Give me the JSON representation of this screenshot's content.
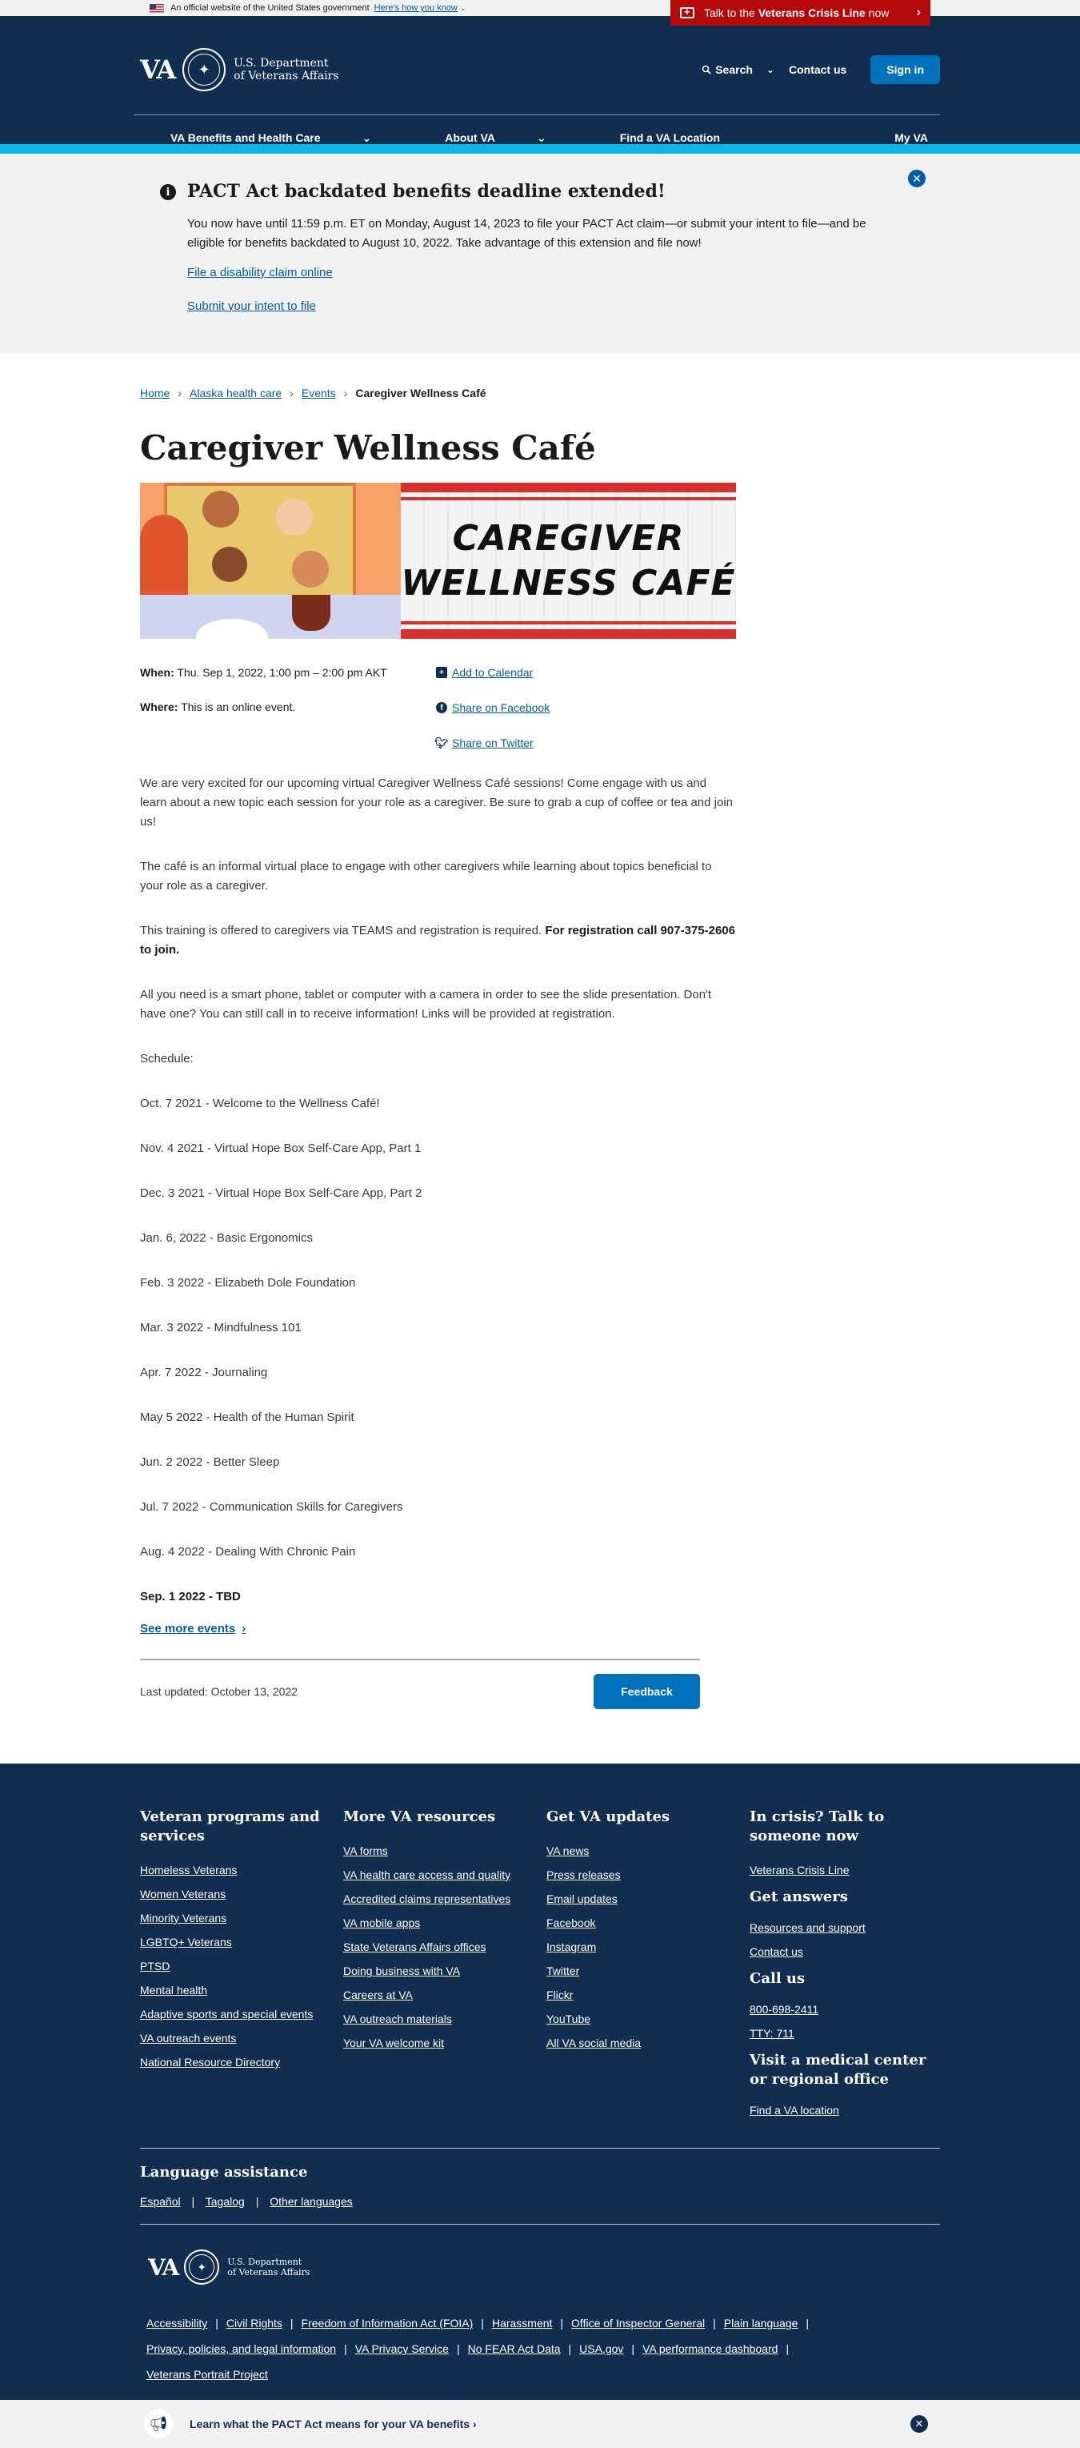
{
  "official_banner": {
    "text": "An official website of the United States government",
    "link": "Here's how you know"
  },
  "crisis_line": {
    "prefix": "Talk to the",
    "bold": "Veterans Crisis Line",
    "suffix": "now"
  },
  "header": {
    "logo_text": "VA",
    "dept_line1": "U.S. Department",
    "dept_line2": "of Veterans Affairs",
    "search_label": "Search",
    "contact_label": "Contact us",
    "signin_label": "Sign in",
    "nav": [
      "VA Benefits and Health Care",
      "About VA",
      "Find a VA Location"
    ],
    "myva": "My VA"
  },
  "alert": {
    "title": "PACT Act backdated benefits deadline extended!",
    "body": "You now have until 11:59 p.m. ET on Monday, August 14, 2023 to file your PACT Act claim—or submit your intent to file—and be eligible for benefits backdated to August 10, 2022. Take advantage of this extension and file now!",
    "link1": "File a disability claim online",
    "link2": "Submit your intent to file"
  },
  "breadcrumb": {
    "items": [
      "Home",
      "Alaska health care",
      "Events"
    ],
    "current": "Caregiver Wellness Café"
  },
  "page": {
    "title": "Caregiver Wellness Café",
    "hero_line1": "CAREGIVER",
    "hero_line2": "WELLNESS CAFÉ",
    "when_label": "When:",
    "when_value": "Thu. Sep 1, 2022, 1:00 pm – 2:00 pm AKT",
    "where_label": "Where:",
    "where_value": "This is an online event.",
    "add_calendar": "Add to Calendar",
    "share_facebook": "Share on Facebook",
    "share_twitter": "Share on Twitter",
    "p1": "We are very excited for our upcoming virtual Caregiver Wellness Café sessions! Come engage with us and learn about a new topic each session for your role as a caregiver. Be sure to grab a cup of coffee or tea and join us!",
    "p2": "The café is an informal virtual place to engage with other caregivers while learning about topics beneficial to your role as a caregiver.",
    "p3_plain": "This training is offered to caregivers via TEAMS and registration is required.",
    "p3_bold": "For registration call 907-375-2606 to join.",
    "p4": "All you need is a smart phone, tablet or computer with a camera in order to see the slide presentation. Don't have one? You can still call in to receive information! Links will be provided at registration.",
    "schedule_label": "Schedule:",
    "schedule": [
      "Oct. 7 2021 - Welcome to the Wellness Café!",
      "Nov. 4 2021 - Virtual Hope Box Self-Care App, Part 1",
      "Dec. 3 2021 - Virtual Hope Box Self-Care App, Part 2",
      "Jan. 6, 2022 - Basic Ergonomics",
      "Feb. 3 2022 - Elizabeth Dole Foundation",
      "Mar. 3 2022 - Mindfulness 101",
      "Apr. 7 2022 - Journaling",
      "May 5 2022 - Health of the Human Spirit",
      "Jun. 2 2022 - Better Sleep",
      "Jul. 7 2022 - Communication Skills for Caregivers",
      "Aug. 4 2022 - Dealing With Chronic Pain"
    ],
    "schedule_last": "Sep. 1 2022 - TBD",
    "see_more": "See more events",
    "last_updated": "Last updated: October 13, 2022",
    "feedback": "Feedback"
  },
  "footer": {
    "col1_title": "Veteran programs and services",
    "col1_links": [
      "Homeless Veterans",
      "Women Veterans",
      "Minority Veterans",
      "LGBTQ+ Veterans",
      "PTSD",
      "Mental health",
      "Adaptive sports and special events",
      "VA outreach events",
      "National Resource Directory"
    ],
    "col2_title": "More VA resources",
    "col2_links": [
      "VA forms",
      "VA health care access and quality",
      "Accredited claims representatives",
      "VA mobile apps",
      "State Veterans Affairs offices",
      "Doing business with VA",
      "Careers at VA",
      "VA outreach materials",
      "Your VA welcome kit"
    ],
    "col3_title": "Get VA updates",
    "col3_links": [
      "VA news",
      "Press releases",
      "Email updates",
      "Facebook",
      "Instagram",
      "Twitter",
      "Flickr",
      "YouTube",
      "All VA social media"
    ],
    "col4_title1": "In crisis? Talk to someone now",
    "col4_link1": "Veterans Crisis Line",
    "col4_title2": "Get answers",
    "col4_links2": [
      "Resources and support",
      "Contact us"
    ],
    "col4_title3": "Call us",
    "col4_links3": [
      "800-698-2411",
      "TTY: 711"
    ],
    "col4_title4": "Visit a medical center or regional office",
    "col4_link4": "Find a VA location",
    "lang_title": "Language assistance",
    "lang_links": [
      "Español",
      "Tagalog",
      "Other languages"
    ],
    "bottom_links_row1": [
      "Accessibility",
      "Civil Rights",
      "Freedom of Information Act (FOIA)",
      "Harassment",
      "Office of Inspector General",
      "Plain language"
    ],
    "bottom_links_row2": [
      "Privacy, policies, and legal information",
      "VA Privacy Service",
      "No FEAR Act Data",
      "USA.gov",
      "VA performance dashboard"
    ],
    "bottom_links_row3": [
      "Veterans Portrait Project"
    ]
  },
  "pact_bar": {
    "text": "Learn what the PACT Act means for your VA benefits ›"
  }
}
